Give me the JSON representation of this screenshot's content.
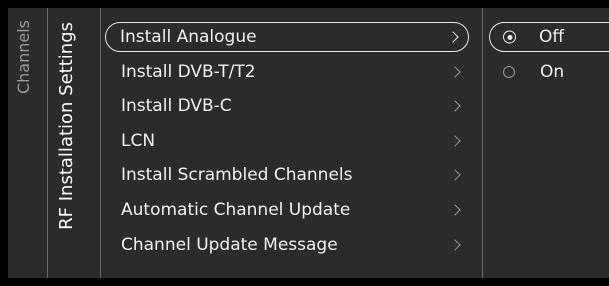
{
  "breadcrumb": {
    "parent": "Channels",
    "current": "RF Installation Settings"
  },
  "menu": {
    "items": [
      {
        "label": "Install Analogue",
        "focused": true
      },
      {
        "label": "Install DVB-T/T2",
        "focused": false
      },
      {
        "label": "Install DVB-C",
        "focused": false
      },
      {
        "label": "LCN",
        "focused": false
      },
      {
        "label": "Install Scrambled Channels",
        "focused": false
      },
      {
        "label": "Automatic Channel Update",
        "focused": false
      },
      {
        "label": "Channel Update Message",
        "focused": false
      }
    ]
  },
  "options": {
    "items": [
      {
        "label": "Off",
        "selected": true
      },
      {
        "label": "On",
        "selected": false
      }
    ]
  },
  "colors": {
    "background": "#000000",
    "panel": "#2b2b2b",
    "divider": "#6a6a6a",
    "text": "#f2f2f2",
    "dim_text": "#9b9b9b",
    "focus_outline": "#e6e6e6"
  },
  "icons": {
    "submenu": "chevron-right-icon",
    "radio_selected": "radio-selected-icon",
    "radio_unselected": "radio-unselected-icon"
  }
}
